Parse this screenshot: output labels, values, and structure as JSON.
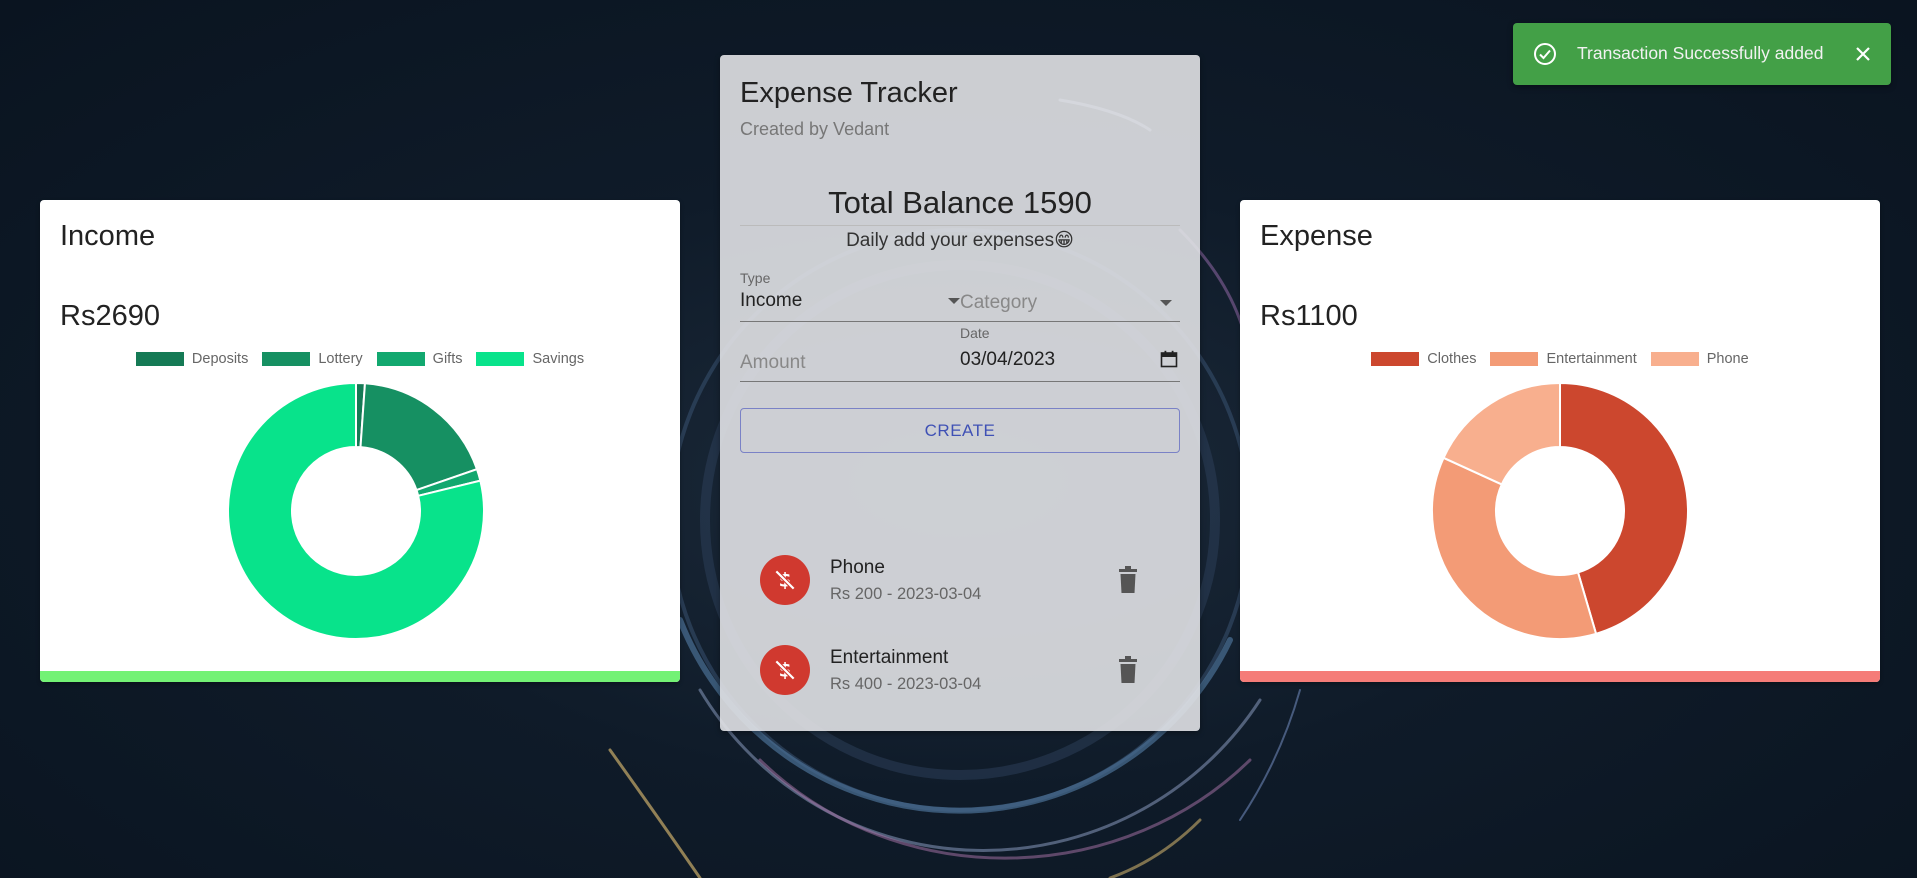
{
  "toast": {
    "message": "Transaction Successfully added",
    "icon": "check-circle-icon",
    "close_icon": "close-icon",
    "color": "#43a047"
  },
  "income": {
    "title": "Income",
    "amount": "Rs2690",
    "accent_color": "#73f275",
    "chart_data": {
      "type": "pie",
      "categories": [
        "Deposits",
        "Lottery",
        "Gifts",
        "Savings"
      ],
      "values": [
        30,
        500,
        40,
        2120
      ],
      "colors": [
        "#157a55",
        "#169062",
        "#12a86f",
        "#08e38b"
      ],
      "legend": "top"
    }
  },
  "expense": {
    "title": "Expense",
    "amount": "Rs1100",
    "accent_color": "#f57c78",
    "chart_data": {
      "type": "pie",
      "categories": [
        "Clothes",
        "Entertainment",
        "Phone"
      ],
      "values": [
        500,
        400,
        200
      ],
      "colors": [
        "#cc472e",
        "#f39b76",
        "#f8af8e"
      ],
      "legend": "top"
    }
  },
  "main": {
    "title": "Expense Tracker",
    "subtitle": "Created by Vedant",
    "balance": "Total Balance 1590",
    "hint": "Daily add your expenses😁",
    "form": {
      "type_label": "Type",
      "type_value": "Income",
      "category_placeholder": "Category",
      "amount_placeholder": "Amount",
      "date_label": "Date",
      "date_value": "03/04/2023",
      "create_label": "CREATE"
    },
    "transactions": [
      {
        "name": "Phone",
        "meta": "Rs 200 - 2023-03-04",
        "icon": "money-off-icon"
      },
      {
        "name": "Entertainment",
        "meta": "Rs 400 - 2023-03-04",
        "icon": "money-off-icon"
      }
    ]
  }
}
